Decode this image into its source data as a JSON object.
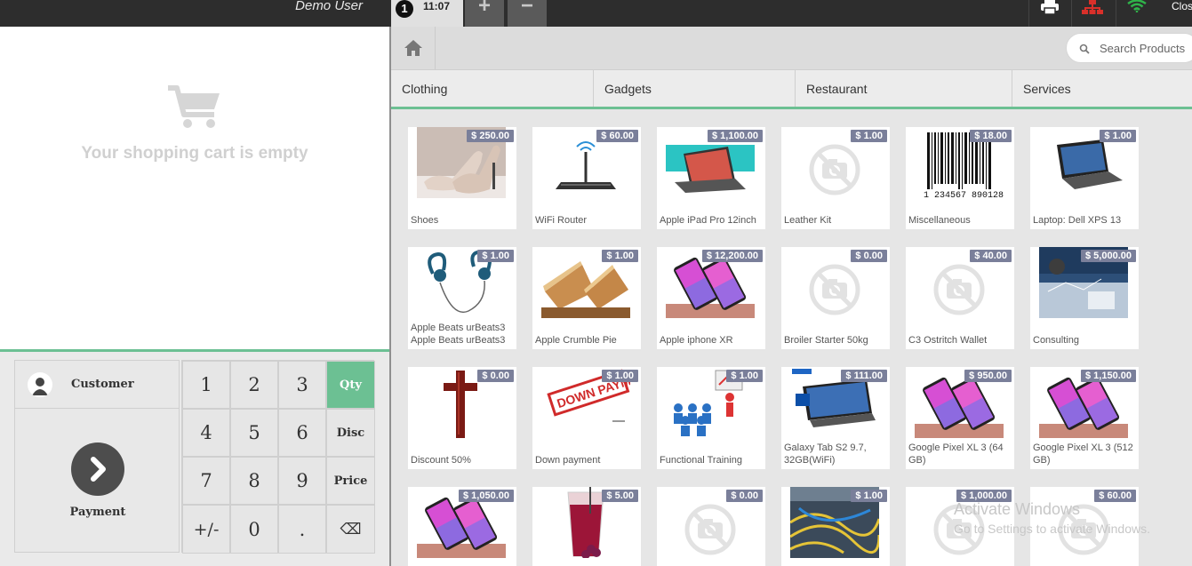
{
  "topbar": {
    "user_name": "Demo User",
    "order_number": "1",
    "order_time": "11:07",
    "add_label": "+",
    "remove_label": "−",
    "close_label": "Clos"
  },
  "cart": {
    "empty_text": "Your shopping cart is empty"
  },
  "controls": {
    "customer_label": "Customer",
    "payment_label": "Payment",
    "keys": [
      "1",
      "2",
      "3",
      "Qty",
      "4",
      "5",
      "6",
      "Disc",
      "7",
      "8",
      "9",
      "Price",
      "+/-",
      "0",
      ".",
      "⌫"
    ]
  },
  "search": {
    "placeholder": "Search Products"
  },
  "categories": [
    "Clothing",
    "Gadgets",
    "Restaurant",
    "Services"
  ],
  "products": [
    {
      "name": "Shoes",
      "price": "$ 250.00",
      "image": "shoes"
    },
    {
      "name": "WiFi Router",
      "price": "$ 60.00",
      "image": "router"
    },
    {
      "name": "Apple iPad Pro 12inch",
      "price": "$ 1,100.00",
      "image": "ipad"
    },
    {
      "name": "Leather Kit",
      "price": "$ 1.00",
      "image": "no-image"
    },
    {
      "name": "Miscellaneous",
      "price": "$ 18.00",
      "image": "barcode"
    },
    {
      "name": "Laptop: Dell XPS 13",
      "price": "$ 1.00",
      "image": "laptop"
    },
    {
      "name": "Apple Beats urBeats3 Apple Beats urBeats3",
      "price": "$ 1.00",
      "image": "earphones"
    },
    {
      "name": "Apple Crumble Pie",
      "price": "$ 1.00",
      "image": "pie"
    },
    {
      "name": "Apple iphone XR",
      "price": "$ 12,200.00",
      "image": "phones"
    },
    {
      "name": "Broiler Starter 50kg",
      "price": "$ 0.00",
      "image": "no-image"
    },
    {
      "name": "C3 Ostritch Wallet",
      "price": "$ 40.00",
      "image": "no-image"
    },
    {
      "name": "Consulting",
      "price": "$ 5,000.00",
      "image": "consulting"
    },
    {
      "name": "Discount 50%",
      "price": "$ 0.00",
      "image": "cross"
    },
    {
      "name": "Down payment",
      "price": "$ 1.00",
      "image": "stamp"
    },
    {
      "name": "Functional Training",
      "price": "$ 1.00",
      "image": "training"
    },
    {
      "name": "Galaxy Tab S2 9.7, 32GB(WiFi)",
      "price": "$ 111.00",
      "image": "tablet"
    },
    {
      "name": "Google Pixel XL 3 (64 GB)",
      "price": "$ 950.00",
      "image": "phones"
    },
    {
      "name": "Google Pixel XL 3 (512 GB)",
      "price": "$ 1,150.00",
      "image": "phones"
    },
    {
      "name": "",
      "price": "$ 1,050.00",
      "image": "phones"
    },
    {
      "name": "",
      "price": "$ 5.00",
      "image": "drink"
    },
    {
      "name": "",
      "price": "$ 0.00",
      "image": "no-image"
    },
    {
      "name": "",
      "price": "$ 1.00",
      "image": "cables"
    },
    {
      "name": "",
      "price": "$ 1,000.00",
      "image": "no-image"
    },
    {
      "name": "",
      "price": "$ 60.00",
      "image": "no-image"
    }
  ],
  "watermark": {
    "line1": "Activate Windows",
    "line2": "Go to Settings to activate Windows."
  },
  "colors": {
    "accent": "#6cc093",
    "topbar": "#2d2d2d",
    "price_badge": "#7a7f9a",
    "dark_button": "#4d4d4d"
  }
}
